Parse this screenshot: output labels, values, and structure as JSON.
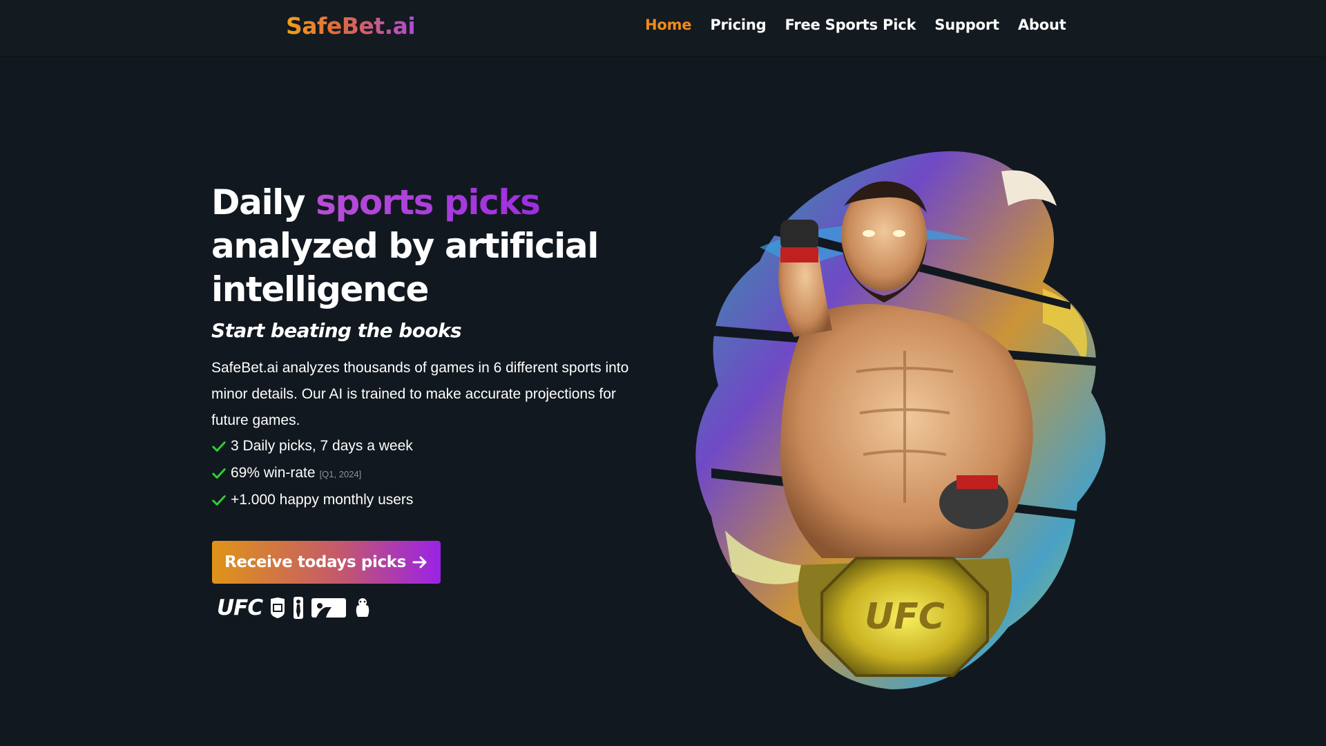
{
  "brand": {
    "logo": "SafeBet.ai"
  },
  "nav": {
    "items": [
      {
        "label": "Home",
        "active": true
      },
      {
        "label": "Pricing",
        "active": false
      },
      {
        "label": "Free Sports Pick",
        "active": false
      },
      {
        "label": "Support",
        "active": false
      },
      {
        "label": "About",
        "active": false
      }
    ]
  },
  "hero": {
    "headline_part1": "Daily ",
    "headline_accent": "sports picks",
    "headline_part2": "analyzed by artificial intelligence",
    "subheadline": "Start beating the books",
    "description": "SafeBet.ai analyzes thousands of games in 6 different sports into minor details. Our AI is trained to make accurate projections for future games.",
    "features": [
      {
        "text": "3 Daily picks, 7 days a week",
        "note": ""
      },
      {
        "text": "69% win-rate",
        "note": "[Q1, 2024]"
      },
      {
        "text": "+1.000 happy monthly users",
        "note": ""
      }
    ],
    "cta_label": "Receive todays picks",
    "leagues": {
      "ufc_label": "UFC",
      "icons": [
        "nfl-icon",
        "nba-icon",
        "mlb-icon",
        "premier-league-icon"
      ]
    }
  },
  "colors": {
    "background": "#12181f",
    "nav_active": "#f08a1c",
    "accent_purple": "#a63de0",
    "cta_start": "#e09418",
    "cta_end": "#9a22e6",
    "check_green": "#2fd02f"
  }
}
